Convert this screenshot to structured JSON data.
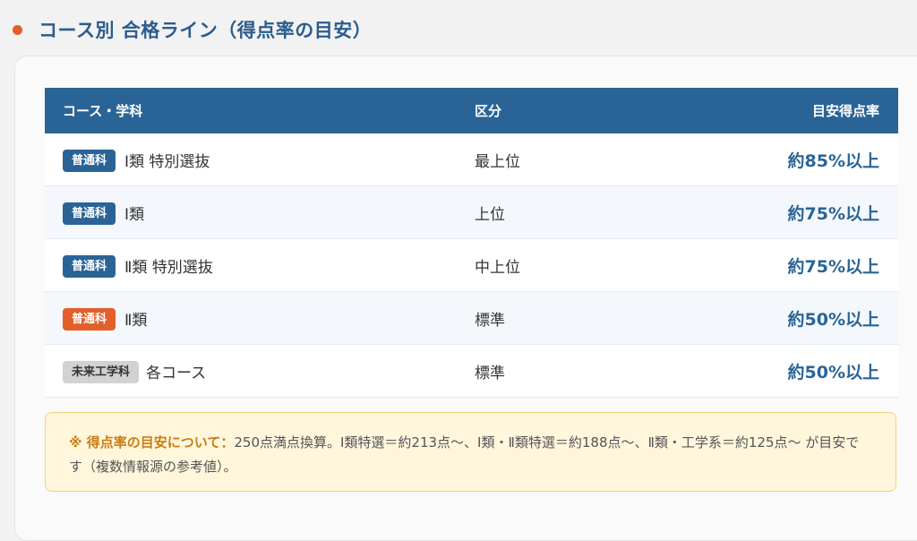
{
  "heading": {
    "title": "コース別 合格ライン（得点率の目安）"
  },
  "colors": {
    "accent_blue": "#2a6496",
    "accent_orange": "#e35f2a",
    "badge_gray": "#d2d2d2",
    "note_bg": "#fff6dc",
    "note_label": "#c97d12"
  },
  "table": {
    "headers": {
      "course": "コース・学科",
      "category": "区分",
      "rate": "目安得点率"
    },
    "rows": [
      {
        "badge": "普通科",
        "badge_color": "blue",
        "course": "Ⅰ類 特別選抜",
        "category": "最上位",
        "rate": "約85%以上"
      },
      {
        "badge": "普通科",
        "badge_color": "blue",
        "course": "Ⅰ類",
        "category": "上位",
        "rate": "約75%以上"
      },
      {
        "badge": "普通科",
        "badge_color": "blue",
        "course": "Ⅱ類 特別選抜",
        "category": "中上位",
        "rate": "約75%以上"
      },
      {
        "badge": "普通科",
        "badge_color": "orange",
        "course": "Ⅱ類",
        "category": "標準",
        "rate": "約50%以上"
      },
      {
        "badge": "未来工学科",
        "badge_color": "gray",
        "course": "各コース",
        "category": "標準",
        "rate": "約50%以上"
      }
    ]
  },
  "note": {
    "label": "※ 得点率の目安について：",
    "text": "250点満点換算。Ⅰ類特選＝約213点〜、Ⅰ類・Ⅱ類特選＝約188点〜、Ⅱ類・工学系＝約125点〜 が目安です（複数情報源の参考値）。"
  }
}
